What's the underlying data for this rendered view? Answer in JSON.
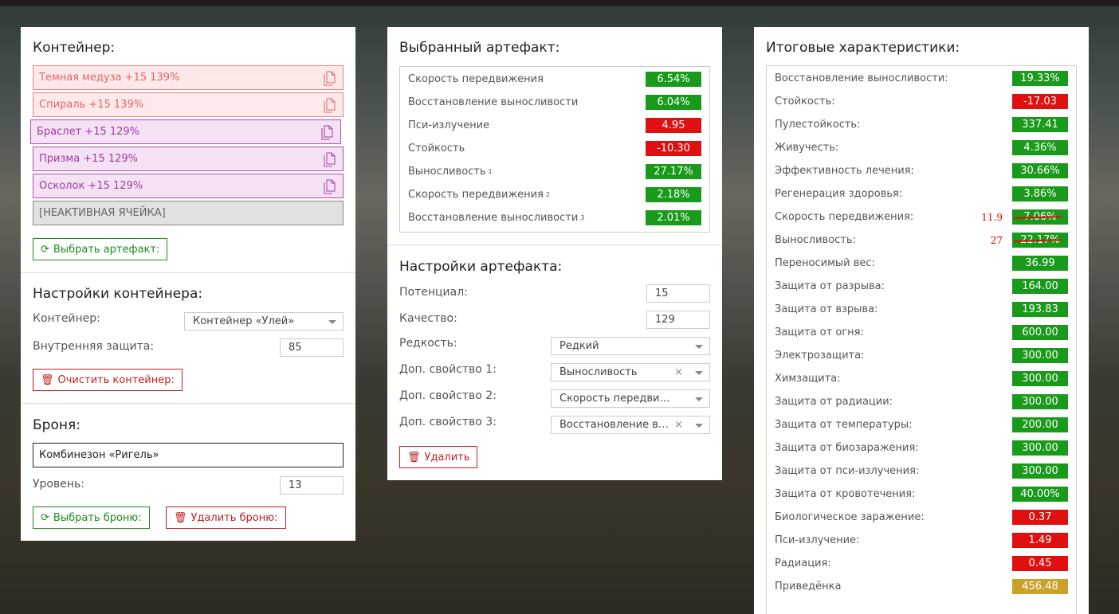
{
  "container_panel": {
    "title": "Контейнер:",
    "slots": [
      {
        "label": "Темная медуза +15 139%",
        "style": "red"
      },
      {
        "label": "Спираль +15 139%",
        "style": "red"
      },
      {
        "label": "Браслет +15 129%",
        "style": "purple"
      },
      {
        "label": "Призма +15 129%",
        "style": "purple"
      },
      {
        "label": "Осколок +15 129%",
        "style": "purple"
      },
      {
        "label": "[НЕАКТИВНАЯ ЯЧЕЙКА]",
        "style": "grey"
      }
    ],
    "choose_button": "Выбрать артефакт:",
    "settings_title": "Настройки контейнера:",
    "container_label": "Контейнер:",
    "container_value": "Контейнер «Улей»",
    "inner_protection_label": "Внутренняя защита:",
    "inner_protection_value": "85",
    "clear_button": "Очистить контейнер:",
    "armor_title": "Броня:",
    "armor_value": "Комбинезон «Ригель»",
    "level_label": "Уровень:",
    "level_value": "13",
    "choose_armor_button": "Выбрать броню:",
    "delete_armor_button": "Удалить броню:"
  },
  "artifact_panel": {
    "title": "Выбранный артефакт:",
    "stats": [
      {
        "label": "Скорость передвижения",
        "sup": "",
        "value": "6.54%",
        "color": "g"
      },
      {
        "label": "Восстановление выносливости",
        "sup": "",
        "value": "6.04%",
        "color": "g"
      },
      {
        "label": "Пси-излучение",
        "sup": "",
        "value": "4.95",
        "color": "r"
      },
      {
        "label": "Стойкость",
        "sup": "",
        "value": "-10.30",
        "color": "r"
      },
      {
        "label": "Выносливость",
        "sup": "1",
        "value": "27.17%",
        "color": "g"
      },
      {
        "label": "Скорость передвижения",
        "sup": "2",
        "value": "2.18%",
        "color": "g"
      },
      {
        "label": "Восстановление выносливости",
        "sup": "3",
        "value": "2.01%",
        "color": "g"
      }
    ],
    "settings_title": "Настройки артефакта:",
    "potential_label": "Потенциал:",
    "potential_value": "15",
    "quality_label": "Качество:",
    "quality_value": "129",
    "rarity_label": "Редкость:",
    "rarity_value": "Редкий",
    "extra1_label": "Доп. свойство 1:",
    "extra1_value": "Выносливость",
    "extra2_label": "Доп. свойство 2:",
    "extra2_value": "Скорость передвижения",
    "extra3_label": "Доп. свойство 3:",
    "extra3_value": "Восстановление выносливости",
    "delete_button": "Удалить",
    "clear_glyph": "×"
  },
  "totals_panel": {
    "title": "Итоговые характеристики:",
    "stats": [
      {
        "label": "Восстановление выносливости:",
        "value": "19.33%",
        "color": "g",
        "old": ""
      },
      {
        "label": "Стойкость:",
        "value": "-17.03",
        "color": "r",
        "old": ""
      },
      {
        "label": "Пулестойкость:",
        "value": "337.41",
        "color": "g",
        "old": ""
      },
      {
        "label": "Живучесть:",
        "value": "4.36%",
        "color": "g",
        "old": ""
      },
      {
        "label": "Эффективность лечения:",
        "value": "30.66%",
        "color": "g",
        "old": ""
      },
      {
        "label": "Регенерация здоровья:",
        "value": "3.86%",
        "color": "g",
        "old": ""
      },
      {
        "label": "Скорость передвижения:",
        "value": "7.06%",
        "color": "g",
        "old": "11.9"
      },
      {
        "label": "Выносливость:",
        "value": "22.17%",
        "color": "g",
        "old": "27"
      },
      {
        "label": "Переносимый вес:",
        "value": "36.99",
        "color": "g",
        "old": ""
      },
      {
        "label": "Защита от разрыва:",
        "value": "164.00",
        "color": "g",
        "old": ""
      },
      {
        "label": "Защита от взрыва:",
        "value": "193.83",
        "color": "g",
        "old": ""
      },
      {
        "label": "Защита от огня:",
        "value": "600.00",
        "color": "g",
        "old": ""
      },
      {
        "label": "Электрозащита:",
        "value": "300.00",
        "color": "g",
        "old": ""
      },
      {
        "label": "Химзащита:",
        "value": "300.00",
        "color": "g",
        "old": ""
      },
      {
        "label": "Защита от радиации:",
        "value": "300.00",
        "color": "g",
        "old": ""
      },
      {
        "label": "Защита от температуры:",
        "value": "200.00",
        "color": "g",
        "old": ""
      },
      {
        "label": "Защита от биозаражения:",
        "value": "300.00",
        "color": "g",
        "old": ""
      },
      {
        "label": "Защита от пси-излучения:",
        "value": "300.00",
        "color": "g",
        "old": ""
      },
      {
        "label": "Защита от кровотечения:",
        "value": "40.00%",
        "color": "g",
        "old": ""
      },
      {
        "label": "Биологическое заражение:",
        "value": "0.37",
        "color": "r",
        "old": ""
      },
      {
        "label": "Пси-излучение:",
        "value": "1.49",
        "color": "r",
        "old": ""
      },
      {
        "label": "Радиация:",
        "value": "0.45",
        "color": "r",
        "old": ""
      },
      {
        "label": "Приведёнка",
        "value": "456.48",
        "color": "y",
        "old": ""
      }
    ]
  },
  "colors": {
    "green": "#1a9a1a",
    "red": "#e01010",
    "yellow": "#c9a227"
  }
}
